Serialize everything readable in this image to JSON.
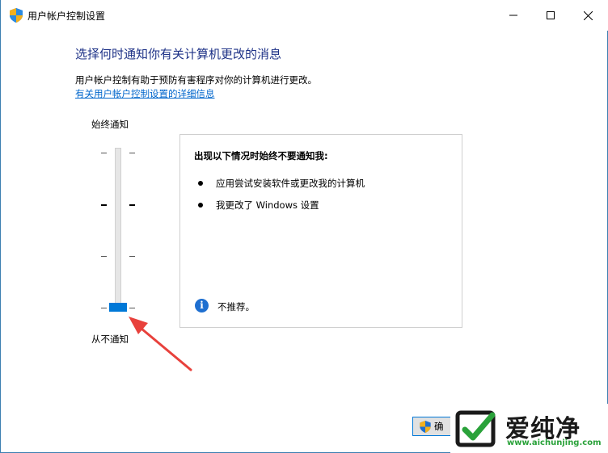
{
  "window": {
    "title": "用户帐户控制设置",
    "controls": [
      "minimize-icon",
      "maximize-icon",
      "close-icon"
    ]
  },
  "main": {
    "heading": "选择何时通知你有关计算机更改的消息",
    "description": "用户帐户控制有助于预防有害程序对你的计算机进行更改。",
    "help_link": "有关用户帐户控制设置的详细信息"
  },
  "slider": {
    "top_label": "始终通知",
    "bottom_label": "从不通知",
    "levels": 4,
    "selected_level": 1
  },
  "panel": {
    "heading": "出现以下情况时始终不要通知我:",
    "bullets": [
      "应用尝试安装软件或更改我的计算机",
      "我更改了 Windows 设置"
    ],
    "recommendation": "不推荐。"
  },
  "footer": {
    "confirm_label": "确"
  },
  "watermark": {
    "brand": "爱纯净",
    "url": "www.aichunjing.com"
  },
  "colors": {
    "accent": "#0078d7",
    "heading": "#1e3287",
    "link": "#0066cc",
    "annotation": "#e8413c",
    "info_icon": "#1e6fd0",
    "watermark_green": "#2aa23a"
  }
}
